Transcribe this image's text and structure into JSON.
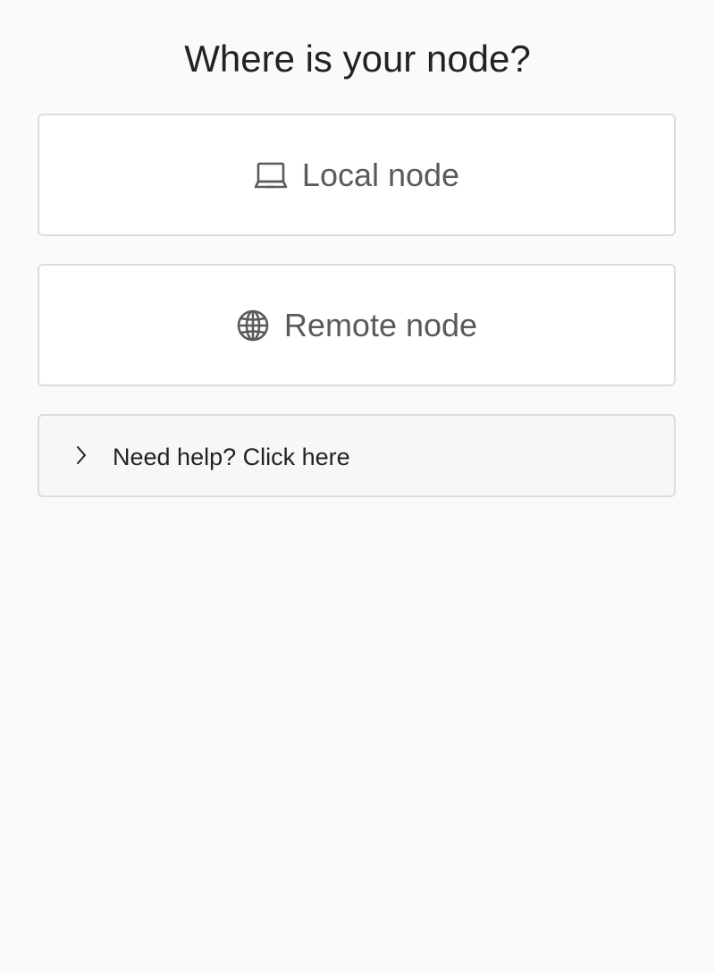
{
  "page": {
    "title": "Where is your node?"
  },
  "options": {
    "local": {
      "label": "Local node",
      "icon": "laptop-icon"
    },
    "remote": {
      "label": "Remote node",
      "icon": "globe-icon"
    }
  },
  "help": {
    "label": "Need help? Click here",
    "icon": "chevron-right-icon"
  },
  "colors": {
    "background": "#fafafa",
    "card_background": "#ffffff",
    "card_border": "#dcdcdc",
    "option_text": "#5a5a5a",
    "title_text": "#222222"
  }
}
